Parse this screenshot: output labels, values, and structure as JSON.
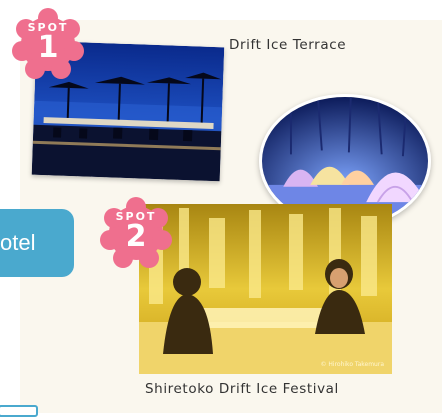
{
  "spots": [
    {
      "badge_word": "SPOT",
      "number": "1",
      "caption": "Drift Ice Terrace"
    },
    {
      "badge_word": "SPOT",
      "number": "2",
      "caption": "Shiretoko Drift Ice Festival",
      "photo_credit": "© Hirohiko Takemura"
    }
  ],
  "side_button": {
    "label": "otel"
  },
  "colors": {
    "badge": "#ef6f8e",
    "button": "#4aa9ce",
    "panel": "#faf7ee"
  },
  "icons": [
    "terrace-photo",
    "igloo-photo",
    "festival-photo",
    "spot-badge"
  ]
}
